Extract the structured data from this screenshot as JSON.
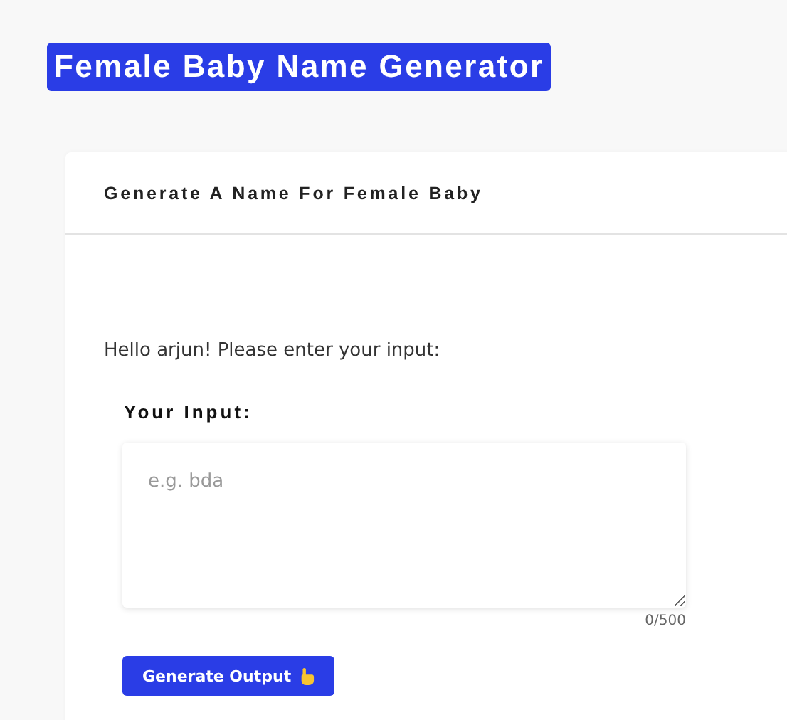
{
  "page_title": "Female Baby Name Generator",
  "card": {
    "title": "Generate A Name For Female Baby",
    "greeting": "Hello arjun! Please enter your input:",
    "input_label": "Your Input:",
    "input": {
      "placeholder": "e.g. bda",
      "counter": "0/500"
    },
    "button": "Generate Output"
  }
}
